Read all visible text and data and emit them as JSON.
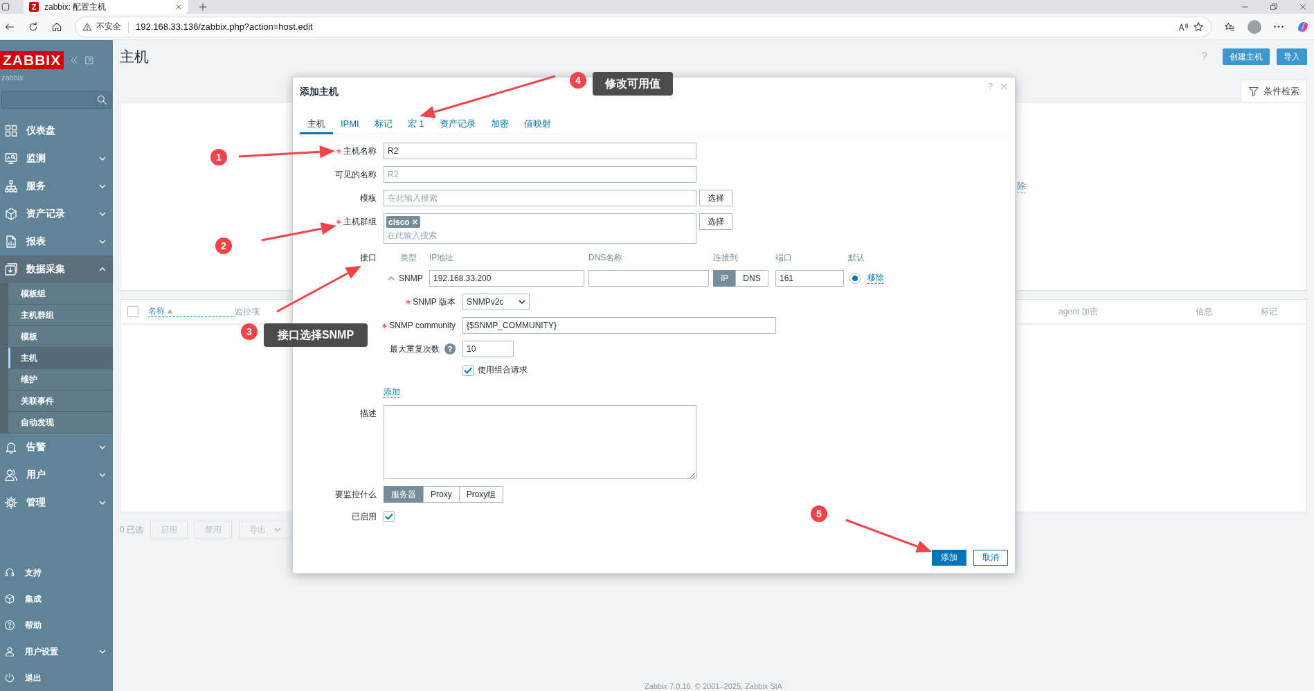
{
  "browser": {
    "tab_title": "zabbix: 配置主机",
    "favicon_letter": "Z",
    "security_label": "不安全",
    "url": "192.168.33.136/zabbix.php?action=host.edit"
  },
  "sidebar": {
    "logo": "ZABBIX",
    "server_name": "zabbix",
    "items": [
      {
        "label": "仪表盘",
        "expandable": false
      },
      {
        "label": "监测",
        "expandable": true,
        "expanded": false
      },
      {
        "label": "服务",
        "expandable": true,
        "expanded": false
      },
      {
        "label": "资产记录",
        "expandable": true,
        "expanded": false
      },
      {
        "label": "报表",
        "expandable": true,
        "expanded": false
      },
      {
        "label": "数据采集",
        "expandable": true,
        "expanded": true,
        "children": [
          {
            "label": "模板组",
            "selected": false
          },
          {
            "label": "主机群组",
            "selected": false
          },
          {
            "label": "模板",
            "selected": false
          },
          {
            "label": "主机",
            "selected": true
          },
          {
            "label": "维护",
            "selected": false
          },
          {
            "label": "关联事件",
            "selected": false
          },
          {
            "label": "自动发现",
            "selected": false
          }
        ]
      },
      {
        "label": "告警",
        "expandable": true,
        "expanded": false
      },
      {
        "label": "用户",
        "expandable": true,
        "expanded": false
      },
      {
        "label": "管理",
        "expandable": true,
        "expanded": false
      }
    ],
    "bottom_items": [
      {
        "label": "支持",
        "expandable": false
      },
      {
        "label": "集成",
        "expandable": false
      },
      {
        "label": "帮助",
        "expandable": false
      },
      {
        "label": "用户设置",
        "expandable": true,
        "expanded": false
      },
      {
        "label": "退出",
        "expandable": false
      }
    ]
  },
  "page": {
    "title": "主机",
    "help": "?",
    "buttons": [
      {
        "label": "创建主机"
      },
      {
        "label": "导入"
      }
    ],
    "filter_tab": "条件检索",
    "filter_link": "除",
    "table": {
      "select_all_checked": false,
      "columns": [
        {
          "label": "名称",
          "sort_ascending": true
        },
        {
          "label": "监控项"
        },
        {
          "label": "agent 加密"
        },
        {
          "label": "信息"
        },
        {
          "label": "标记"
        }
      ]
    },
    "selected_count": "0 已选",
    "actions": [
      {
        "label": "启用",
        "disabled": true
      },
      {
        "label": "禁用",
        "disabled": true
      },
      {
        "label": "导出",
        "disabled": true,
        "dropdown": true
      }
    ],
    "footer": "Zabbix 7.0.16. © 2001–2025, Zabbix SIA"
  },
  "dialog": {
    "title": "添加主机",
    "help": "?",
    "tabs": [
      {
        "label": "主机",
        "selected": true
      },
      {
        "label": "IPMI",
        "selected": false
      },
      {
        "label": "标记",
        "selected": false
      },
      {
        "label": "宏 1",
        "selected": false
      },
      {
        "label": "资产记录",
        "selected": false
      },
      {
        "label": "加密",
        "selected": false
      },
      {
        "label": "值映射",
        "selected": false
      }
    ],
    "host_name": {
      "label": "主机名称",
      "required": true,
      "value": "R2"
    },
    "visible_name": {
      "label": "可见的名称",
      "placeholder": "R2"
    },
    "templates": {
      "label": "模板",
      "placeholder": "在此输入搜索",
      "button": "选择"
    },
    "host_groups": {
      "label": "主机群组",
      "required": true,
      "tags": [
        "cisco"
      ],
      "placeholder": "在此输入搜索",
      "button": "选择"
    },
    "interfaces": {
      "label": "接口",
      "columns": [
        "类型",
        "IP地址",
        "DNS名称",
        "连接到",
        "端口",
        "默认"
      ],
      "items": [
        {
          "type": "SNMP",
          "expanded": true,
          "ip": "192.168.33.200",
          "connect": [
            {
              "label": "IP",
              "selected": true
            },
            {
              "label": "DNS",
              "selected": false
            }
          ],
          "port": "161",
          "default": true,
          "remove": "移除",
          "details": [
            {
              "kind": "select",
              "label": "SNMP 版本",
              "required": true,
              "value": "SNMPv2c"
            },
            {
              "kind": "input",
              "label": "SNMP community",
              "required": true,
              "value": "{$SNMP_COMMUNITY}"
            },
            {
              "kind": "input",
              "label": "最大重复次数",
              "help": "?",
              "value": "10"
            },
            {
              "kind": "checkbox",
              "label": "使用组合请求",
              "checked": true
            }
          ]
        }
      ],
      "add": "添加"
    },
    "description": {
      "label": "描述"
    },
    "monitored_by": {
      "label": "要监控什么",
      "options": [
        {
          "label": "服务器",
          "selected": true
        },
        {
          "label": "Proxy",
          "selected": false
        },
        {
          "label": "Proxy组",
          "selected": false
        }
      ]
    },
    "enabled": {
      "label": "已启用",
      "checked": true
    },
    "buttons": [
      {
        "label": "添加",
        "primary": true
      },
      {
        "label": "取消",
        "primary": false
      }
    ]
  },
  "annotations": {
    "markers": [
      "1",
      "2",
      "3",
      "4",
      "5"
    ],
    "callouts": [
      "修改可用值",
      "接口选择SNMP"
    ]
  }
}
